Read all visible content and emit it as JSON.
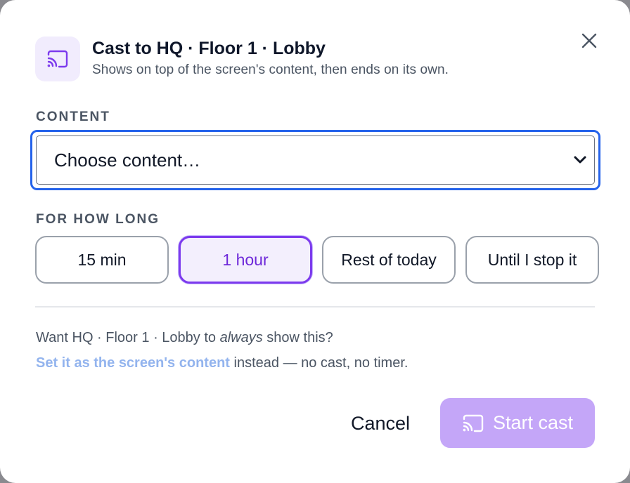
{
  "dialog": {
    "title": "Cast to HQ · Floor 1 · Lobby",
    "subtitle": "Shows on top of the screen's content, then ends on its own.",
    "icons": {
      "header": "cast-icon",
      "close": "close-icon",
      "select": "chevron-down-icon",
      "start": "cast-icon"
    }
  },
  "content_section": {
    "label": "CONTENT",
    "select_value": "Choose content…"
  },
  "duration_section": {
    "label": "FOR HOW LONG",
    "options": [
      "15 min",
      "1 hour",
      "Rest of today",
      "Until I stop it"
    ],
    "selected": "1 hour"
  },
  "note": {
    "line1_before": "Want HQ · Floor 1 · Lobby to ",
    "line1_emph": "always",
    "line1_after": " show this?",
    "link": "Set it as the screen's content",
    "line2_after": " instead — no cast, no timer."
  },
  "actions": {
    "cancel_label": "Cancel",
    "start_label": "Start cast"
  },
  "colors": {
    "accent": "#7c3aed",
    "focus_ring": "#2563eb",
    "start_disabled": "#c4a6f8",
    "link": "#93b4ee"
  }
}
